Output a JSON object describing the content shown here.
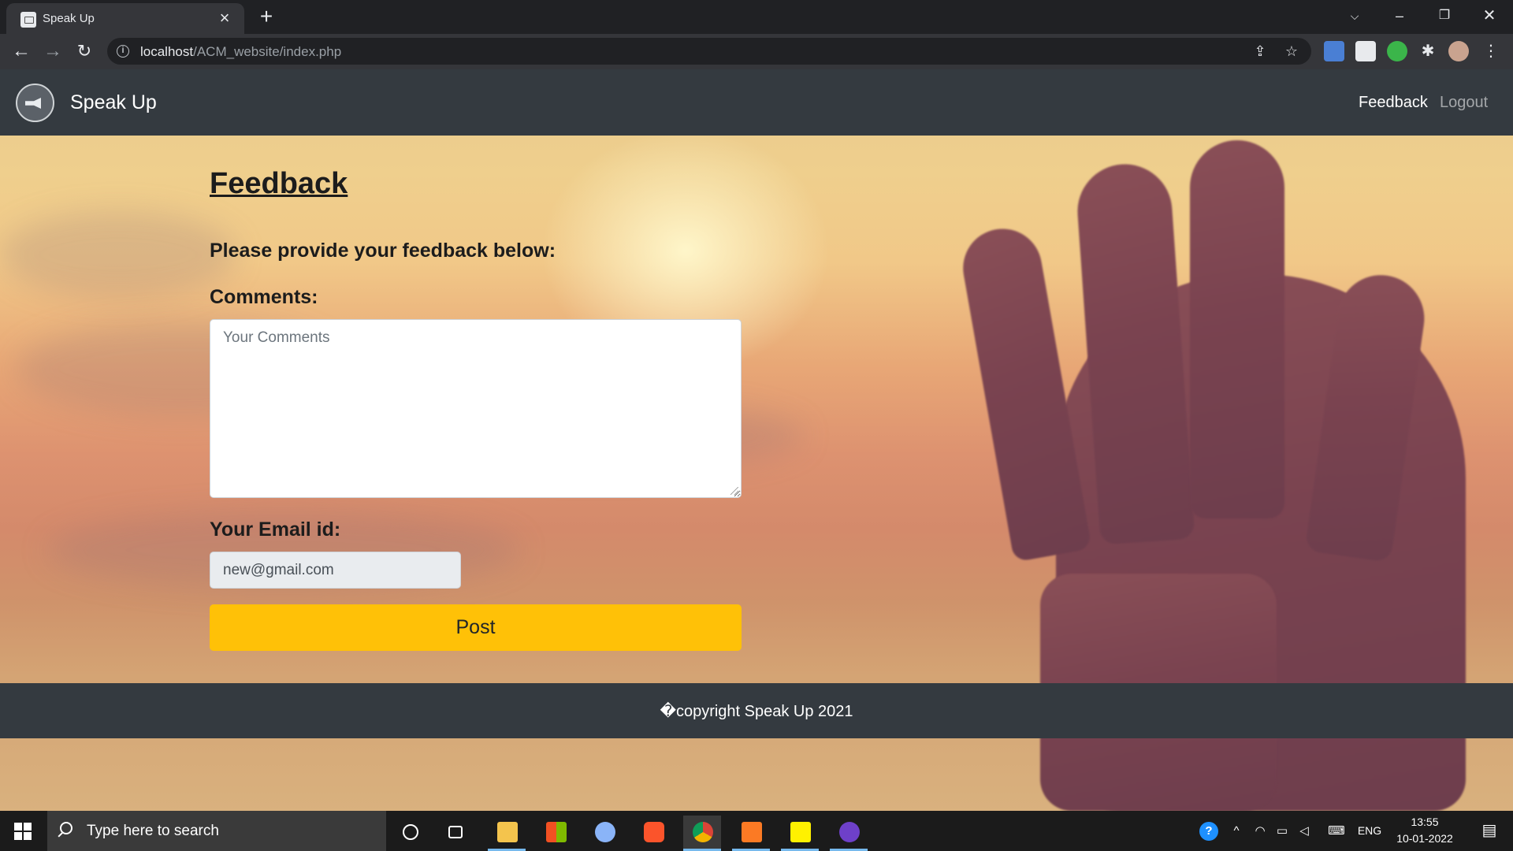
{
  "browser": {
    "tab_title": "Speak Up",
    "url_host": "localhost",
    "url_path": "/ACM_website/index.php"
  },
  "navbar": {
    "brand": "Speak Up",
    "links": [
      {
        "label": "Feedback",
        "active": true
      },
      {
        "label": "Logout",
        "active": false
      }
    ]
  },
  "form": {
    "heading": "Feedback",
    "subheading": "Please provide your feedback below:",
    "comments_label": "Comments:",
    "comments_placeholder": "Your Comments",
    "email_label": "Your Email id:",
    "email_value": "new@gmail.com",
    "submit_label": "Post"
  },
  "footer": {
    "copyright": "�copyright Speak Up 2021"
  },
  "taskbar": {
    "search_placeholder": "Type here to search",
    "language": "ENG",
    "time": "13:55",
    "date": "10-01-2022"
  },
  "colors": {
    "navbar": "#343a40",
    "button": "#ffc107",
    "taskbar": "#1b1b1b"
  }
}
